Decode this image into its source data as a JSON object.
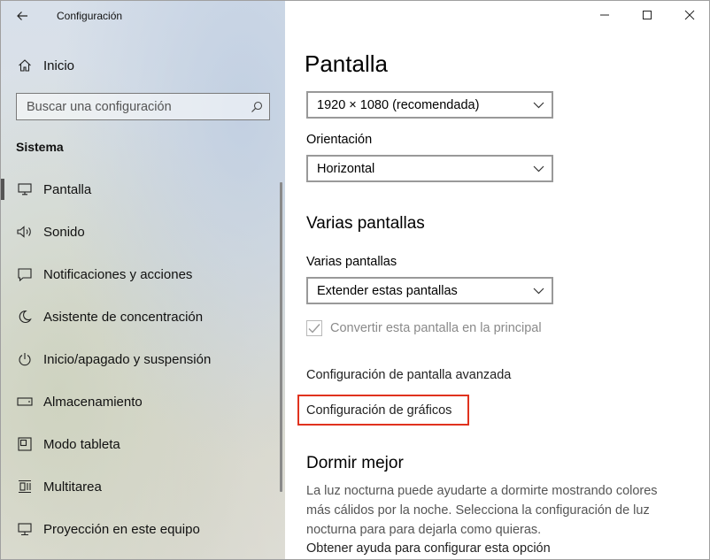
{
  "window": {
    "title": "Configuración"
  },
  "sidebar": {
    "home_label": "Inicio",
    "search": {
      "placeholder": "Buscar una configuración"
    },
    "section_title": "Sistema",
    "items": [
      {
        "label": "Pantalla",
        "icon": "monitor-icon",
        "selected": true
      },
      {
        "label": "Sonido",
        "icon": "speaker-icon",
        "selected": false
      },
      {
        "label": "Notificaciones y acciones",
        "icon": "notification-icon",
        "selected": false
      },
      {
        "label": "Asistente de concentración",
        "icon": "moon-icon",
        "selected": false
      },
      {
        "label": "Inicio/apagado y suspensión",
        "icon": "power-icon",
        "selected": false
      },
      {
        "label": "Almacenamiento",
        "icon": "storage-icon",
        "selected": false
      },
      {
        "label": "Modo tableta",
        "icon": "tablet-icon",
        "selected": false
      },
      {
        "label": "Multitarea",
        "icon": "multitask-icon",
        "selected": false
      },
      {
        "label": "Proyección en este equipo",
        "icon": "projection-icon",
        "selected": false
      }
    ]
  },
  "main": {
    "title": "Pantalla",
    "resolution_value": "1920 × 1080 (recomendada)",
    "orientation_label": "Orientación",
    "orientation_value": "Horizontal",
    "multi_display_heading": "Varias pantallas",
    "multi_display_label": "Varias pantallas",
    "multi_display_value": "Extender estas pantallas",
    "make_main_label": "Convertir esta pantalla en la principal",
    "make_main_checked": true,
    "advanced_link": "Configuración de pantalla avanzada",
    "graphics_link": "Configuración de gráficos",
    "sleep_heading": "Dormir mejor",
    "sleep_text": "La luz nocturna puede ayudarte a dormirte mostrando colores más cálidos por la noche. Selecciona la configuración de luz nocturna para para dejarla como quieras.",
    "help_link": "Obtener ayuda para configurar esta opción"
  },
  "colors": {
    "highlight": "#e0321e",
    "selection_bar": "#555555"
  }
}
